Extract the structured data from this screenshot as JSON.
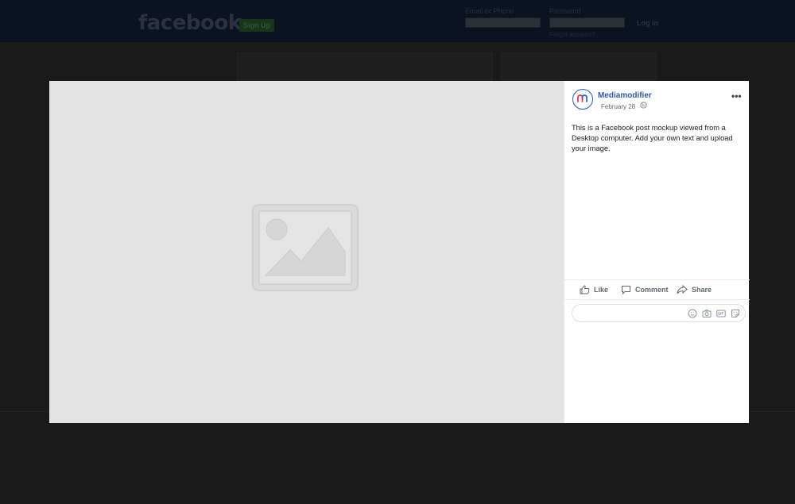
{
  "header": {
    "logo": "facebook",
    "signup_label": "Sign Up",
    "email_label": "Email or Phone",
    "password_label": "Password",
    "login_label": "Log In",
    "forgot_label": "Forgot account?"
  },
  "post": {
    "page_name": "Mediamodifier",
    "date": "February 28",
    "privacy_icon": "globe-icon",
    "more_label": "•••",
    "text": "This is a Facebook post mockup viewed from a Desktop computer. Add your own text and upload your image."
  },
  "actions": {
    "like_label": "Like",
    "comment_label": "Comment",
    "share_label": "Share"
  },
  "comment_box": {
    "icons": [
      "smiley-icon",
      "camera-icon",
      "gif-icon",
      "sticker-icon"
    ]
  },
  "colors": {
    "brand_blue": "#2c5aa8",
    "overlay_bg": "#1a1a1a",
    "media_bg": "#e3e3e3"
  }
}
